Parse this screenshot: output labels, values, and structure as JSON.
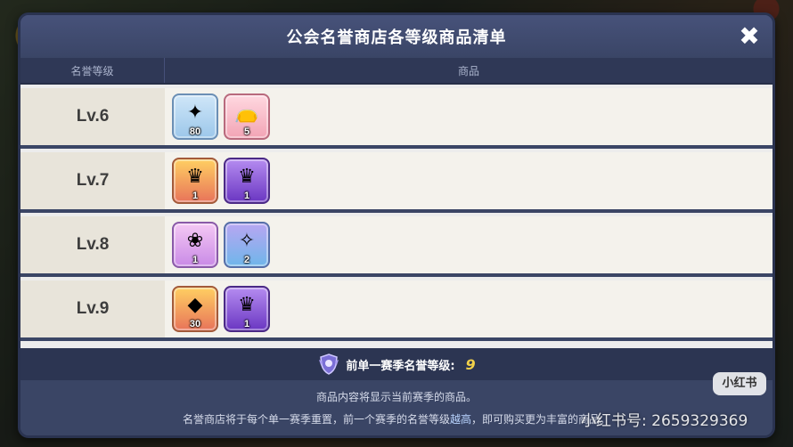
{
  "modal": {
    "title": "公会名誉商店各等级商品清单",
    "close_label": "✖"
  },
  "columns": {
    "level": "名誉等级",
    "items": "商品"
  },
  "rows": [
    {
      "level": "Lv.6",
      "items": [
        {
          "icon": "star-shard-icon",
          "glyph": "✦",
          "count": "80",
          "color": "blue"
        },
        {
          "icon": "cookie-pouch-icon",
          "glyph": "👝",
          "count": "5",
          "color": "pink"
        }
      ]
    },
    {
      "level": "Lv.7",
      "items": [
        {
          "icon": "crest-red-icon",
          "glyph": "♛",
          "count": "1",
          "color": "orange"
        },
        {
          "icon": "crest-gold-icon",
          "glyph": "♛",
          "count": "1",
          "color": "purple"
        }
      ]
    },
    {
      "level": "Lv.8",
      "items": [
        {
          "icon": "crest-pink-icon",
          "glyph": "❀",
          "count": "1",
          "color": "violet"
        },
        {
          "icon": "wand-star-icon",
          "glyph": "✧",
          "count": "2",
          "color": "teal"
        }
      ]
    },
    {
      "level": "Lv.9",
      "items": [
        {
          "icon": "chest-icon",
          "glyph": "◆",
          "count": "30",
          "color": "orange"
        },
        {
          "icon": "crest-gold-icon",
          "glyph": "♛",
          "count": "1",
          "color": "purple"
        }
      ]
    }
  ],
  "season": {
    "label": "前单一赛季名誉等级:",
    "value": "9"
  },
  "notes": {
    "line1": "商品内容将显示当前赛季的商品。",
    "line2_a": "名誉商店将于每个单一赛季重置，前一个赛季的名誉等级",
    "line2_b": "越高",
    "line2_c": "，即可购买更为丰富的商品。"
  },
  "watermark": {
    "badge": "小红书",
    "id": "小红书号: 2659329369"
  },
  "colors": {
    "modal_bg": "#3a4565",
    "row_bg": "#f4f2ec",
    "season_value": "#f2d14a"
  }
}
